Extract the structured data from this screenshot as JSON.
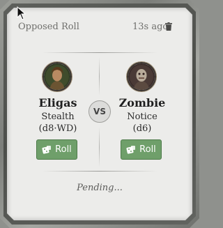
{
  "header": {
    "title": "Opposed Roll",
    "time": "13s ago"
  },
  "icons": {
    "delete": "trash-icon",
    "roll": "dice-icon",
    "pointer": "mouse-cursor"
  },
  "left": {
    "name": "Eligas",
    "skill": "Stealth",
    "die": "(d8·WD)",
    "roll_label": "Roll"
  },
  "right": {
    "name": "Zombie",
    "skill": "Notice",
    "die": "(d6)",
    "roll_label": "Roll"
  },
  "vs_label": "VS",
  "status": "Pending...",
  "colors": {
    "roll_button": "#6f9f6a",
    "card": "#ececea",
    "frame": "#7c7e7a"
  }
}
